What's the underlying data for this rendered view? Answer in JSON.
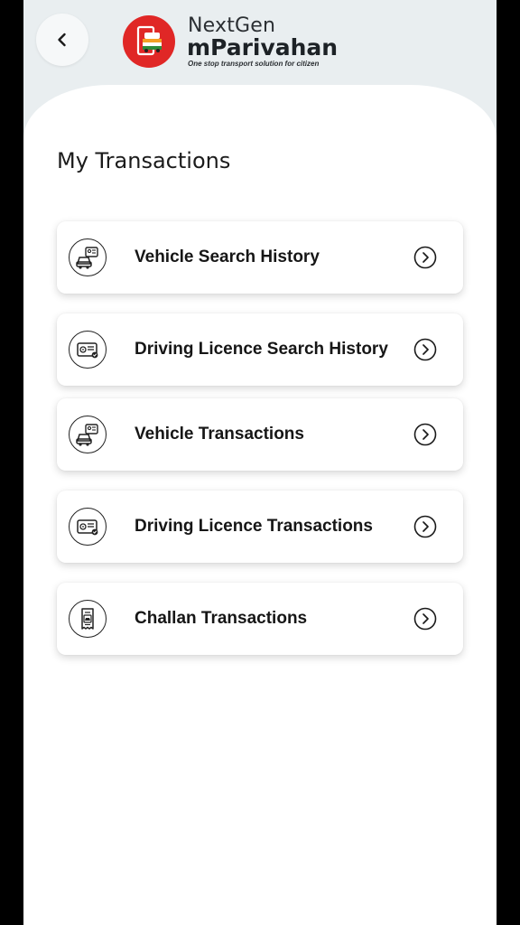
{
  "header": {
    "back_icon": "chevron-left-icon",
    "logo_icon": "mparivahan-logo-icon",
    "brand_line1": "NextGen",
    "brand_line2": "mParivahan",
    "tagline": "One stop transport solution for citizen"
  },
  "page": {
    "title": "My Transactions"
  },
  "menu": {
    "items": [
      {
        "label": "Vehicle Search History",
        "icon": "vehicle-rc-icon"
      },
      {
        "label": "Driving Licence Search History",
        "icon": "driving-licence-icon"
      },
      {
        "label": "Vehicle Transactions",
        "icon": "vehicle-rc-icon"
      },
      {
        "label": "Driving Licence Transactions",
        "icon": "driving-licence-icon"
      },
      {
        "label": "Challan Transactions",
        "icon": "challan-receipt-icon"
      }
    ],
    "chevron_icon": "chevron-right-circle-icon"
  },
  "colors": {
    "brand_red": "#e02726",
    "header_bg": "#e9eef0",
    "card_bg": "#ffffff"
  }
}
